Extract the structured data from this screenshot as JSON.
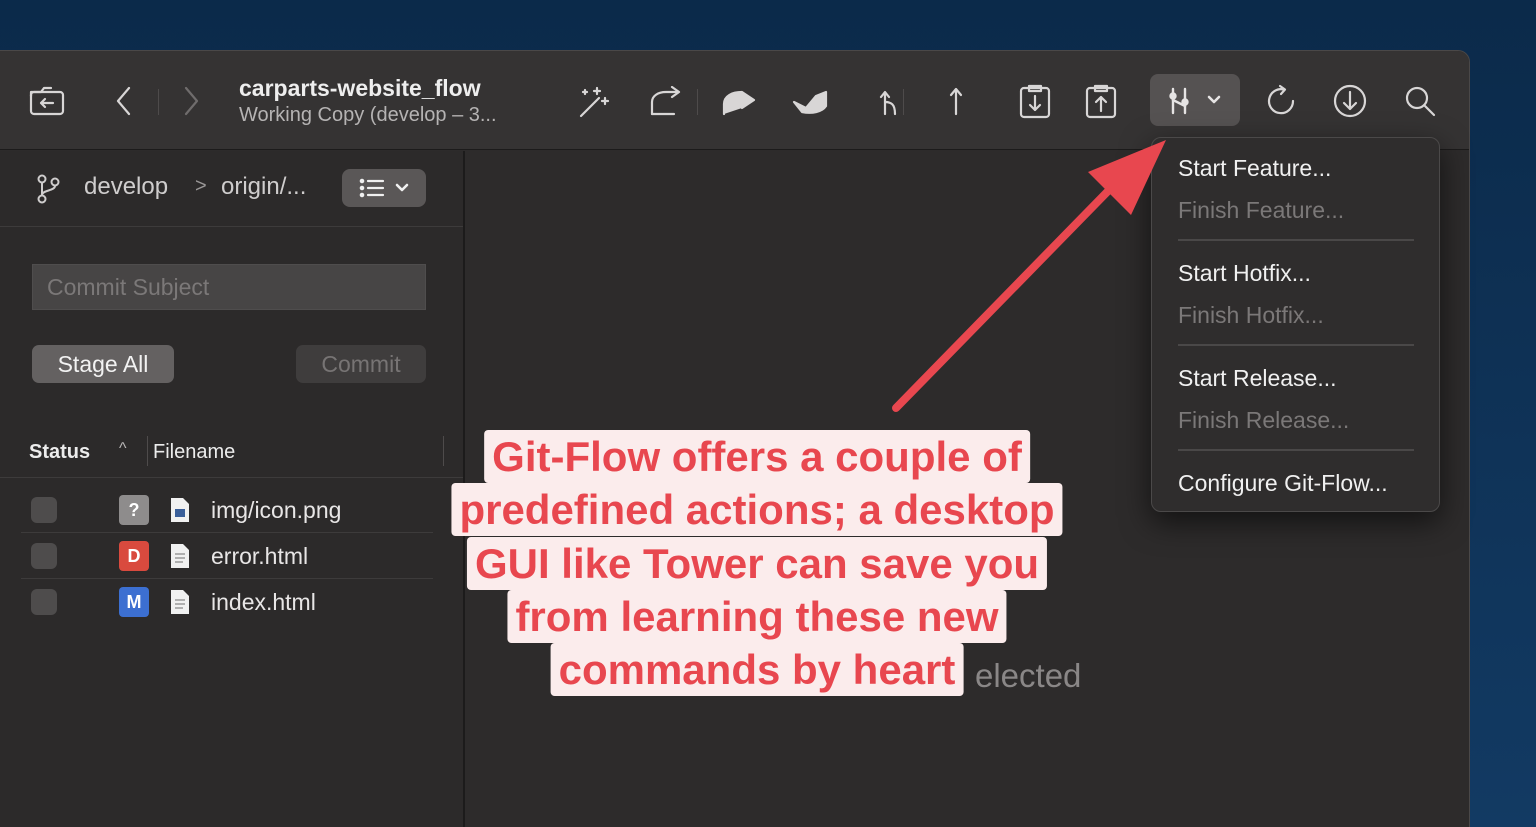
{
  "toolbar": {
    "repo_title": "carparts-website_flow",
    "repo_subtitle": "Working Copy (develop – 3..."
  },
  "sidebar": {
    "branch": "develop",
    "separator": ">",
    "remote": "origin/...",
    "commit_placeholder": "Commit Subject",
    "stage_all_label": "Stage All",
    "commit_label": "Commit",
    "columns": {
      "status": "Status",
      "filename": "Filename"
    },
    "files": [
      {
        "badge": "?",
        "badge_color": "#8e8c8c",
        "name": "img/icon.png"
      },
      {
        "badge": "D",
        "badge_color": "#d94a3e",
        "name": "error.html"
      },
      {
        "badge": "M",
        "badge_color": "#3c6fd1",
        "name": "index.html"
      }
    ]
  },
  "main": {
    "empty_text": "elected"
  },
  "gitflow_menu": {
    "items": [
      {
        "label": "Start Feature...",
        "enabled": true
      },
      {
        "label": "Finish Feature...",
        "enabled": false
      },
      {
        "label": "Start Hotfix...",
        "enabled": true
      },
      {
        "label": "Finish Hotfix...",
        "enabled": false
      },
      {
        "label": "Start Release...",
        "enabled": true
      },
      {
        "label": "Finish Release...",
        "enabled": false
      },
      {
        "label": "Configure Git-Flow...",
        "enabled": true
      }
    ]
  },
  "annotation": {
    "lines": [
      "Git-Flow offers  a couple of",
      "predefined actions; a desktop",
      "GUI like Tower can save you",
      "from learning these new",
      "commands by heart"
    ],
    "color": "#e8474f"
  }
}
